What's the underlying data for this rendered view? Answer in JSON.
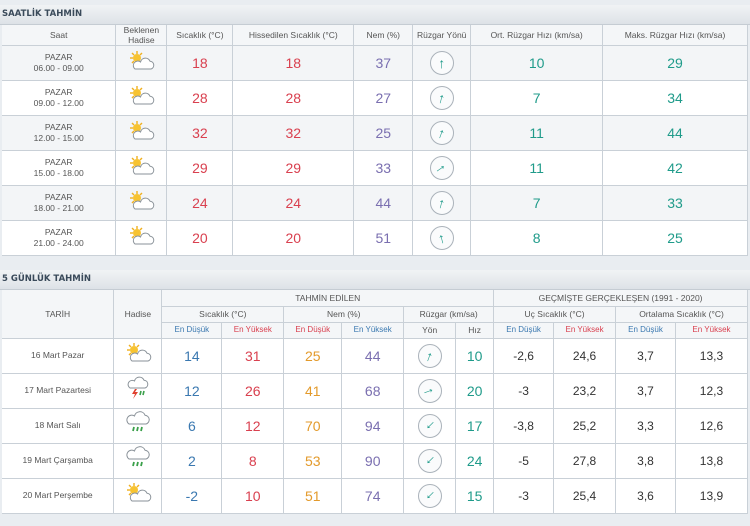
{
  "hourly": {
    "title": "SAATLİK TAHMİN",
    "headers": {
      "time": "Saat",
      "weather_line1": "Beklenen",
      "weather_line2": "Hadise",
      "temp": "Sıcaklık (°C)",
      "feels": "Hissedilen Sıcaklık (°C)",
      "humidity": "Nem (%)",
      "wind_dir": "Rüzgar Yönü",
      "avg_wind": "Ort. Rüzgar Hızı (km/sa)",
      "max_wind": "Maks. Rüzgar Hızı (km/sa)"
    },
    "rows": [
      {
        "day": "PAZAR",
        "time": "06.00 - 09.00",
        "icon": "partly-sunny-icon",
        "temp": "18",
        "feels": "18",
        "humidity": "37",
        "wind_deg": 0,
        "avg": "10",
        "max": "29"
      },
      {
        "day": "PAZAR",
        "time": "09.00 - 12.00",
        "icon": "partly-sunny-icon",
        "temp": "28",
        "feels": "28",
        "humidity": "27",
        "wind_deg": 15,
        "avg": "7",
        "max": "34"
      },
      {
        "day": "PAZAR",
        "time": "12.00 - 15.00",
        "icon": "partly-sunny-icon",
        "temp": "32",
        "feels": "32",
        "humidity": "25",
        "wind_deg": 20,
        "avg": "11",
        "max": "44"
      },
      {
        "day": "PAZAR",
        "time": "15.00 - 18.00",
        "icon": "partly-sunny-icon",
        "temp": "29",
        "feels": "29",
        "humidity": "33",
        "wind_deg": 55,
        "avg": "11",
        "max": "42"
      },
      {
        "day": "PAZAR",
        "time": "18.00 - 21.00",
        "icon": "partly-sunny-icon",
        "temp": "24",
        "feels": "24",
        "humidity": "44",
        "wind_deg": 15,
        "avg": "7",
        "max": "33"
      },
      {
        "day": "PAZAR",
        "time": "21.00 - 24.00",
        "icon": "partly-sunny-icon",
        "temp": "20",
        "feels": "20",
        "humidity": "51",
        "wind_deg": -15,
        "avg": "8",
        "max": "25"
      }
    ]
  },
  "daily": {
    "title": "5 GÜNLÜK TAHMİN",
    "headers": {
      "date": "TARİH",
      "weather": "Hadise",
      "forecast_group": "TAHMİN EDİLEN",
      "past_group": "GEÇMİŞTE GERÇEKLEŞEN (1991 - 2020)",
      "temp": "Sıcaklık (°C)",
      "humidity": "Nem (%)",
      "wind": "Rüzgar (km/sa)",
      "extreme_temp": "Uç Sıcaklık (°C)",
      "avg_temp": "Ortalama Sıcaklık (°C)",
      "min": "En Düşük",
      "max": "En Yüksek",
      "dir": "Yön",
      "speed": "Hız"
    },
    "rows": [
      {
        "date": "16 Mart Pazar",
        "icon": "partly-sunny-icon",
        "tmin": "14",
        "tmax": "31",
        "hmin": "25",
        "hmax": "44",
        "wind_deg": 20,
        "speed": "10",
        "xmin": "-2,6",
        "xmax": "24,6",
        "amin": "3,7",
        "amax": "13,3"
      },
      {
        "date": "17 Mart Pazartesi",
        "icon": "thunderstorm-icon",
        "tmin": "12",
        "tmax": "26",
        "hmin": "41",
        "hmax": "68",
        "wind_deg": 70,
        "speed": "20",
        "xmin": "-3",
        "xmax": "23,2",
        "amin": "3,7",
        "amax": "12,3"
      },
      {
        "date": "18 Mart Salı",
        "icon": "rain-icon",
        "tmin": "6",
        "tmax": "12",
        "hmin": "70",
        "hmax": "94",
        "wind_deg": 225,
        "speed": "17",
        "xmin": "-3,8",
        "xmax": "25,2",
        "amin": "3,3",
        "amax": "12,6"
      },
      {
        "date": "19 Mart Çarşamba",
        "icon": "rain-icon",
        "tmin": "2",
        "tmax": "8",
        "hmin": "53",
        "hmax": "90",
        "wind_deg": 225,
        "speed": "24",
        "xmin": "-5",
        "xmax": "27,8",
        "amin": "3,8",
        "amax": "13,8"
      },
      {
        "date": "20 Mart Perşembe",
        "icon": "partly-sunny-icon",
        "tmin": "-2",
        "tmax": "10",
        "hmin": "51",
        "hmax": "74",
        "wind_deg": 225,
        "speed": "15",
        "xmin": "-3",
        "xmax": "25,4",
        "amin": "3,6",
        "amax": "13,9"
      }
    ]
  }
}
